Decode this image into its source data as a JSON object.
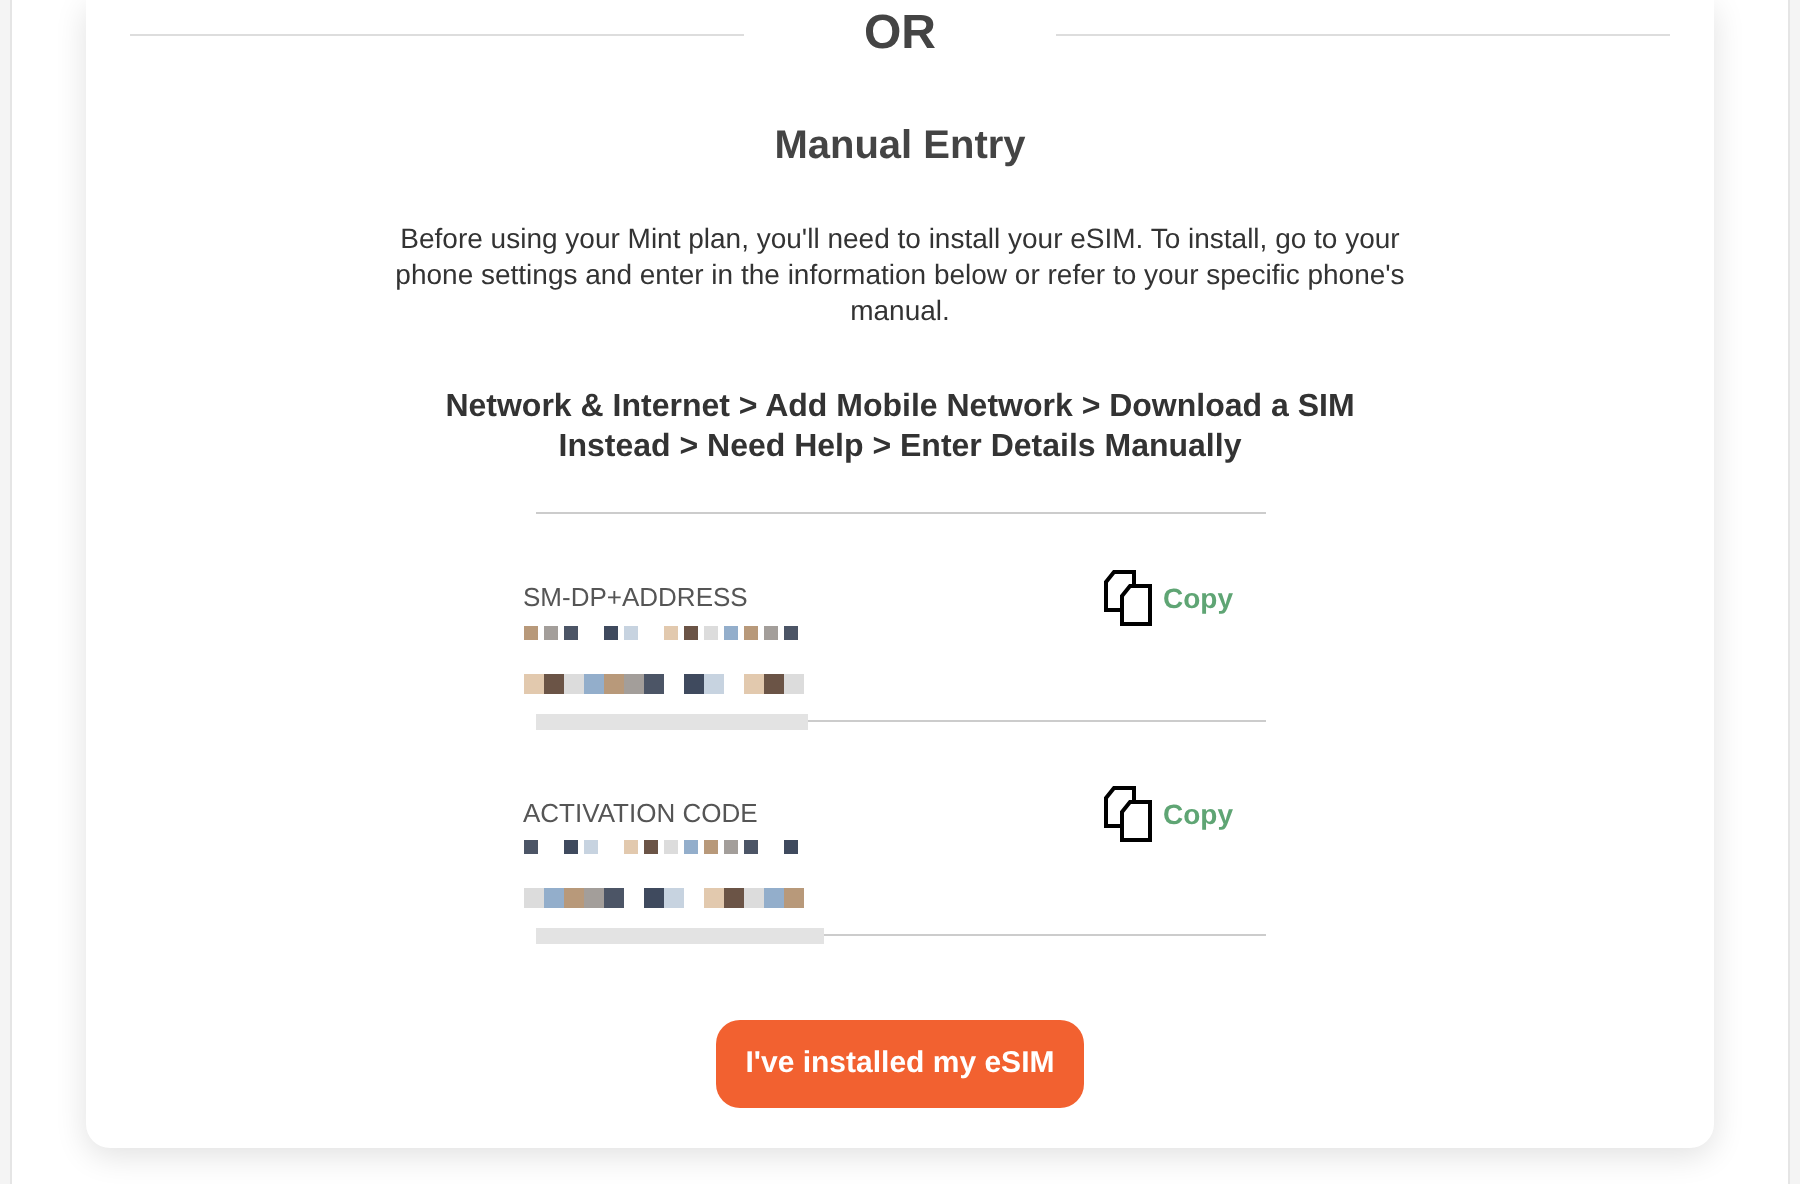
{
  "divider_label": "OR",
  "section": {
    "title": "Manual Entry",
    "description": "Before using your Mint plan, you'll need to install your eSIM. To install, go to your phone settings and enter in the information below or refer to your specific phone's manual.",
    "path": "Network & Internet > Add Mobile Network > Download a SIM Instead > Need Help > Enter Details Manually"
  },
  "fields": [
    {
      "label": "SM-DP+ADDRESS",
      "copy_label": "Copy"
    },
    {
      "label": "ACTIVATION CODE",
      "copy_label": "Copy"
    }
  ],
  "button": "I've installed my eSIM"
}
